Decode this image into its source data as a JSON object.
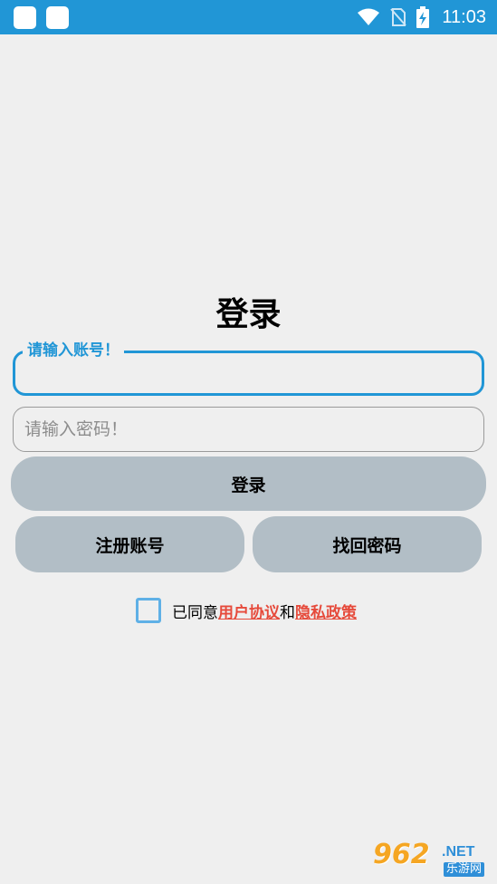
{
  "status_bar": {
    "time": "11:03",
    "icons": [
      "app-icon",
      "app-icon",
      "wifi-icon",
      "no-sim-icon",
      "battery-charging-icon"
    ],
    "color": "#2196d6"
  },
  "page": {
    "title": "登录"
  },
  "account_field": {
    "label": "请输入账号！",
    "value": ""
  },
  "password_field": {
    "placeholder": "请输入密码！",
    "value": ""
  },
  "buttons": {
    "login": "登录",
    "register": "注册账号",
    "forgot": "找回密码"
  },
  "agreement": {
    "prefix": "已同意",
    "user_agreement": "用户协议",
    "and": "和",
    "privacy_policy": "隐私政策",
    "checked": false,
    "link_color": "#e64a3b"
  },
  "watermark": {
    "number": "962",
    "suffix": ".NET",
    "caption": "乐游网"
  }
}
